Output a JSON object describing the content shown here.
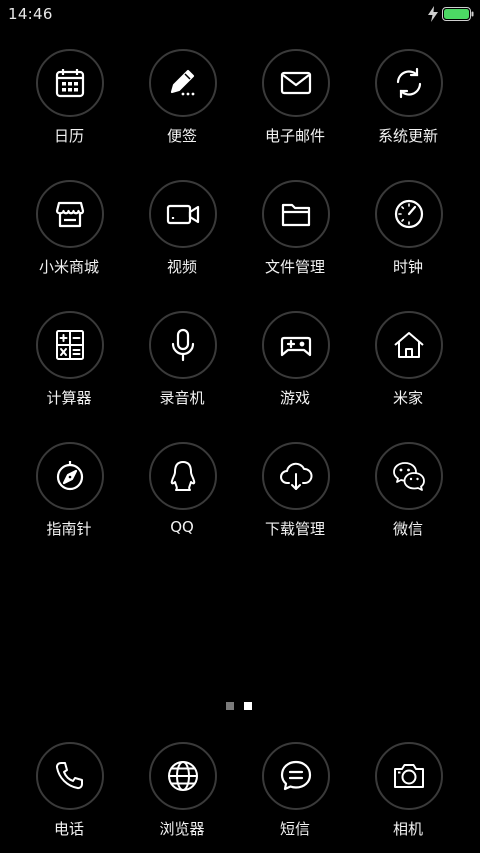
{
  "status_bar": {
    "time": "14:46",
    "battery_color": "#4cd964"
  },
  "apps": [
    {
      "label": "日历",
      "icon": "calendar-icon"
    },
    {
      "label": "便签",
      "icon": "note-pen-icon"
    },
    {
      "label": "电子邮件",
      "icon": "mail-icon"
    },
    {
      "label": "系统更新",
      "icon": "refresh-icon"
    },
    {
      "label": "小米商城",
      "icon": "store-icon"
    },
    {
      "label": "视频",
      "icon": "video-camera-icon"
    },
    {
      "label": "文件管理",
      "icon": "folder-icon"
    },
    {
      "label": "时钟",
      "icon": "clock-icon"
    },
    {
      "label": "计算器",
      "icon": "calculator-icon"
    },
    {
      "label": "录音机",
      "icon": "microphone-icon"
    },
    {
      "label": "游戏",
      "icon": "gamepad-icon"
    },
    {
      "label": "米家",
      "icon": "home-icon"
    },
    {
      "label": "指南针",
      "icon": "compass-icon"
    },
    {
      "label": "QQ",
      "icon": "qq-penguin-icon"
    },
    {
      "label": "下载管理",
      "icon": "cloud-download-icon"
    },
    {
      "label": "微信",
      "icon": "wechat-icon"
    }
  ],
  "page_indicator": {
    "pages": 2,
    "current": 2
  },
  "dock": [
    {
      "label": "电话",
      "icon": "phone-icon"
    },
    {
      "label": "浏览器",
      "icon": "globe-icon"
    },
    {
      "label": "短信",
      "icon": "message-icon"
    },
    {
      "label": "相机",
      "icon": "camera-icon"
    }
  ]
}
